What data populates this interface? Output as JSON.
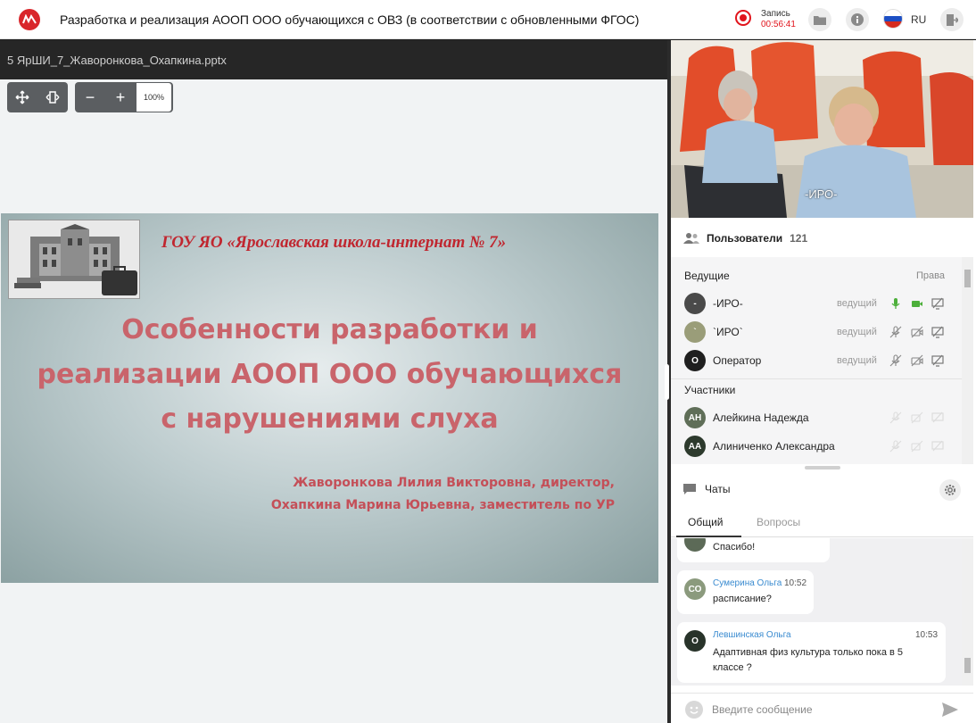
{
  "header": {
    "title": "Разработка и реализация АООП ООО обучающихся с ОВЗ (в соответствии с обновленными ФГОС)",
    "record_label": "Запись",
    "record_time": "00:56:41",
    "language": "RU"
  },
  "presentation": {
    "file_name": "5 ЯрШИ_7_Жаворонкова_Охапкина.pptx",
    "zoom": "100%",
    "zoom_out": "−",
    "zoom_in": "+",
    "slide": {
      "org": "ГОУ ЯО «Ярославская школа-интернат № 7»",
      "title_lines": [
        "Особенности разработки и",
        "реализации АООП ООО обучающихся",
        "с нарушениями слуха"
      ],
      "author_lines": [
        "Жаворонкова Лилия Викторовна, директор,",
        "Охапкина Марина Юрьевна, заместитель по УР"
      ]
    }
  },
  "video": {
    "label": "-ИРО-"
  },
  "users": {
    "title": "Пользователи",
    "count": "121",
    "hosts_label": "Ведущие",
    "rights_label": "Права",
    "participants_label": "Участники",
    "hosts": [
      {
        "initials": "-",
        "name": "-ИРО-",
        "role": "ведущий",
        "avatar_color": "#4a4a4a",
        "mic_on": true,
        "cam_on": true
      },
      {
        "initials": "`",
        "name": "`ИРО`",
        "role": "ведущий",
        "avatar_color": "#9a9d79",
        "mic_on": false,
        "cam_on": false
      },
      {
        "initials": "О",
        "name": "Оператор",
        "role": "ведущий",
        "avatar_color": "#1f1f1f",
        "mic_on": false,
        "cam_on": false
      }
    ],
    "participants": [
      {
        "initials": "АН",
        "name": "Алейкина Надежда",
        "avatar_color": "#5f6e58"
      },
      {
        "initials": "АА",
        "name": "Алиниченко Александра",
        "avatar_color": "#2d3a2d"
      }
    ]
  },
  "chats": {
    "title": "Чаты",
    "tab_general": "Общий",
    "tab_questions": "Вопросы",
    "messages": [
      {
        "text": "Спасибо!"
      },
      {
        "initials": "СО",
        "author": "Сумерина Ольга",
        "time": "10:52",
        "text": "расписание?",
        "avatar_color": "#8b9a7d"
      },
      {
        "initials": "О",
        "author": "Левшинская Ольга",
        "time": "10:53",
        "text": "Адаптивная физ культура только пока в 5 классе ?",
        "avatar_color": "#28332a"
      }
    ],
    "input_placeholder": "Введите сообщение"
  },
  "colors": {
    "brand_red": "#d9262b",
    "record_red": "#e1141c",
    "slide_title": "#c9646b",
    "slide_org": "#c0262f",
    "mic_green": "#4caf3a",
    "chat_name_blue": "#3a8bd0"
  }
}
